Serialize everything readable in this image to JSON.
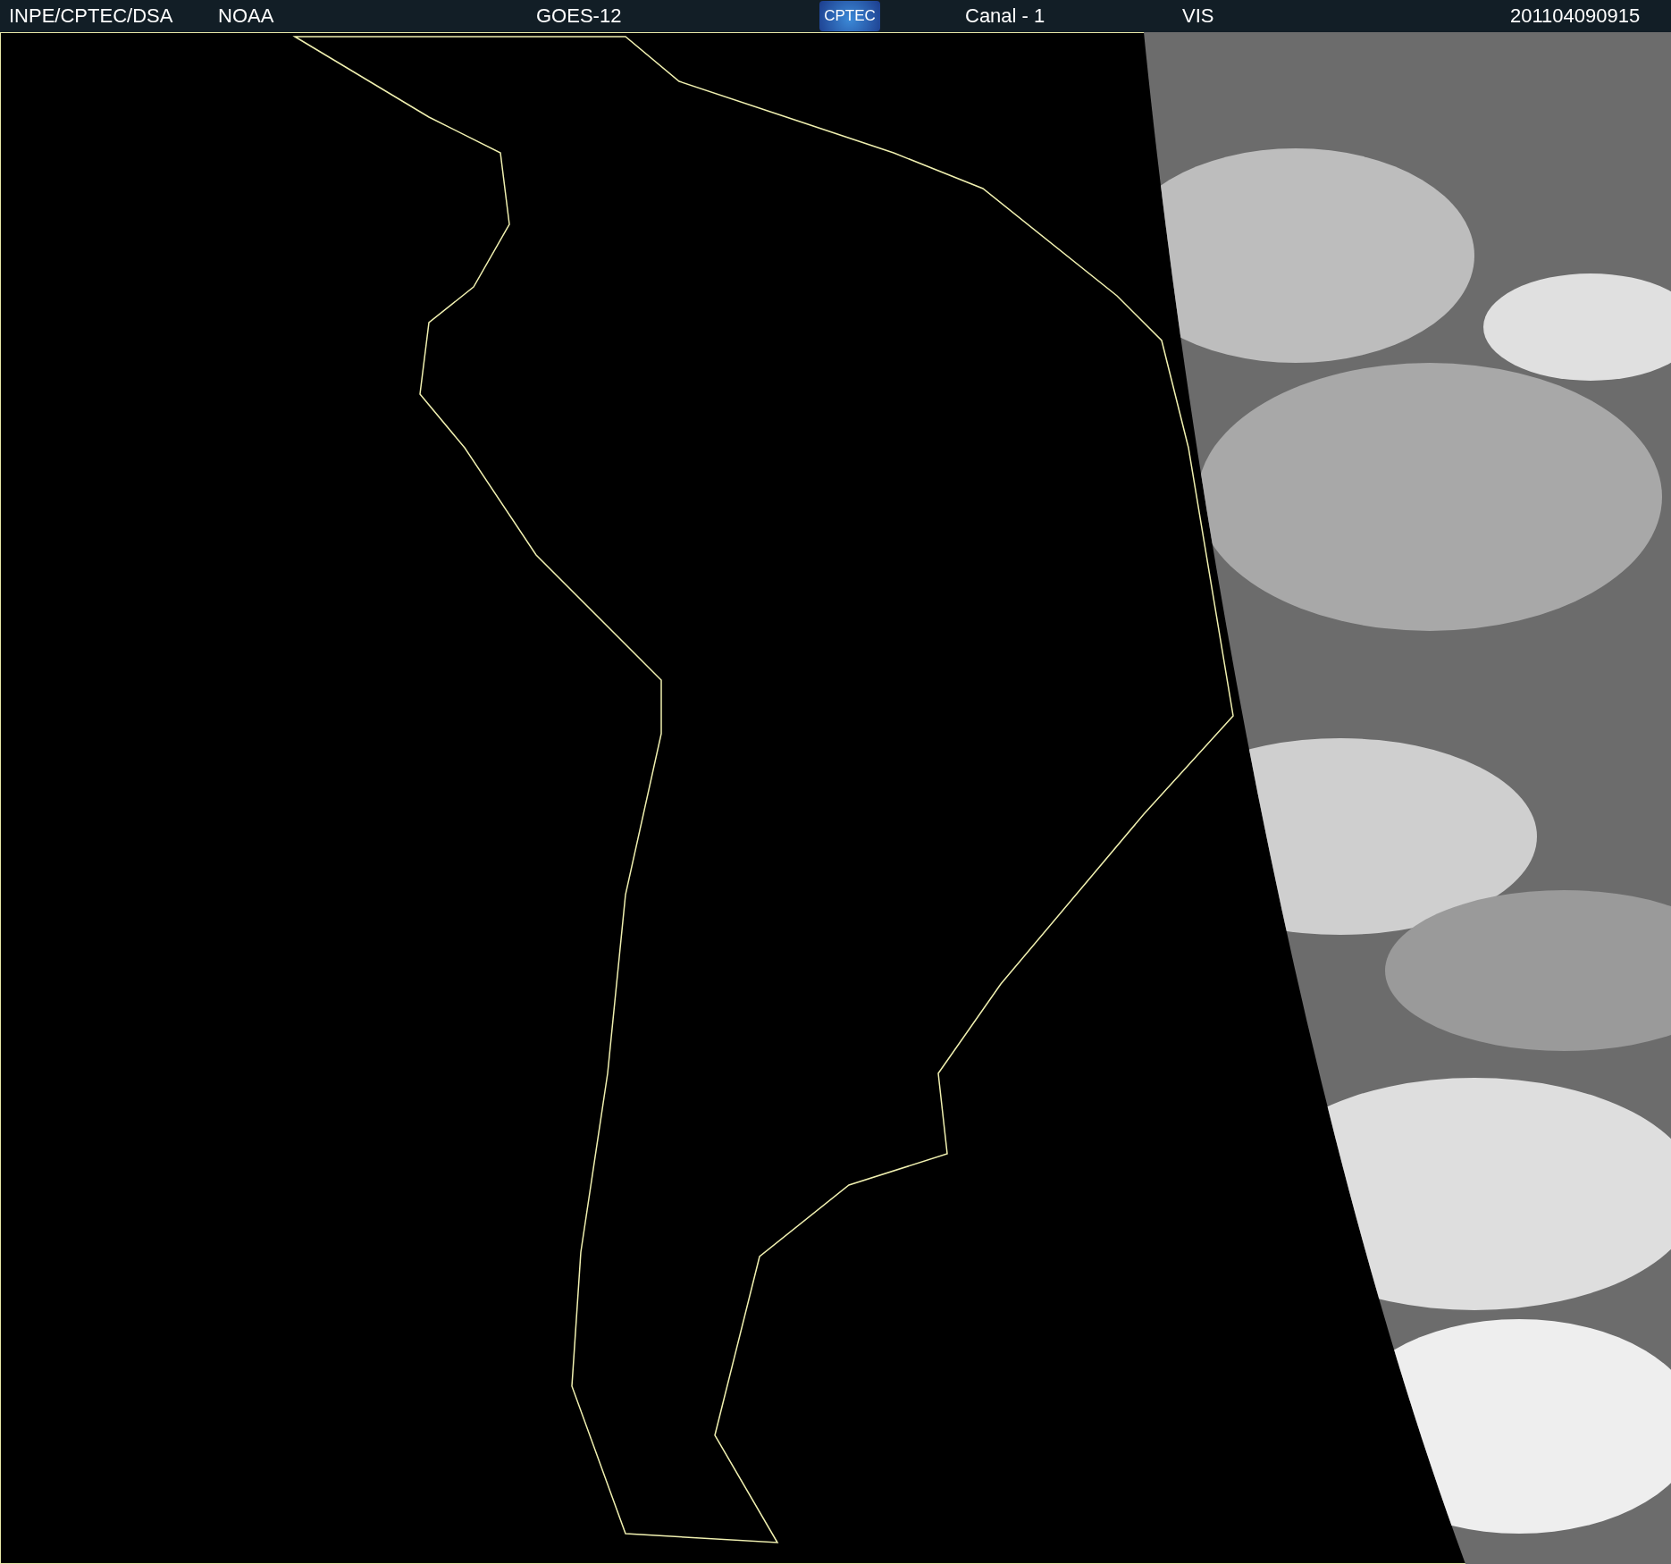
{
  "header": {
    "items": [
      {
        "kind": "text",
        "text": "INPE/CPTEC/DSA"
      },
      {
        "kind": "text",
        "text": "NOAA"
      },
      {
        "kind": "text",
        "text": "GOES-12"
      },
      {
        "kind": "logo",
        "text": "CPTEC"
      },
      {
        "kind": "text",
        "text": "Canal - 1"
      },
      {
        "kind": "text",
        "text": "VIS"
      },
      {
        "kind": "text",
        "text": "201104090915"
      }
    ]
  }
}
